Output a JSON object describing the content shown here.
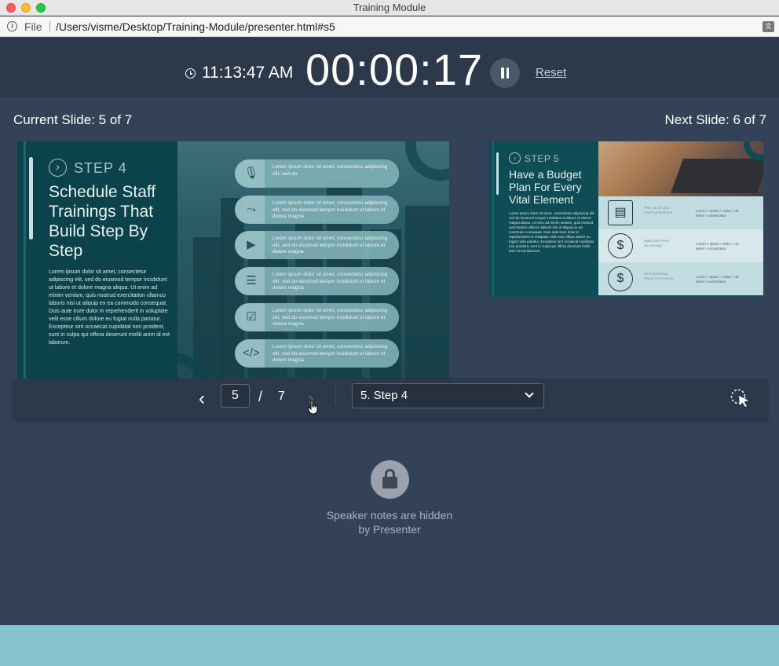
{
  "window": {
    "title": "Training Module"
  },
  "address_bar": {
    "scheme_label": "File",
    "url": "/Users/visme/Desktop/Training-Module/presenter.html#s5"
  },
  "header": {
    "clock_time": "11:13:47 AM",
    "elapsed_time": "00:00:17",
    "reset_label": "Reset"
  },
  "labels": {
    "current_slide": "Current Slide:  5 of 7",
    "next_slide": "Next Slide: 6 of 7"
  },
  "current_slide": {
    "step_label": "STEP 4",
    "title": "Schedule Staff Trainings That Build Step By Step",
    "body": "Lorem ipsum dolor sit amet, consectetur adipiscing elit, sed do eiusmod tempor incididunt ut labore et dolore magna aliqua. Ut enim ad minim veniam, quis nostrud exercitation ullamco laboris nisi ut aliquip ex ea commodo consequat. Duis aute irure dolor in reprehenderit in voluptate velit esse cillum dolore eu fugiat nulla pariatur. Excepteur sint occaecat cupidatat non proident, sunt in culpa qui officia deserunt mollit anim id est laborum.",
    "items": [
      {
        "icon": "microphone-icon",
        "text": "Lorem ipsum dolor sit amet, consectetur adipiscing elit, sed do."
      },
      {
        "icon": "route-icon",
        "text": "Lorem ipsum dolor sit amet, consectetur adipiscing elit, sed do eiusmod tempor incididunt ut labore et dolore magna"
      },
      {
        "icon": "play-video-icon",
        "text": "Lorem ipsum dolor sit amet, consectetur adipiscing elit, sed do eiusmod tempor incididunt ut labore et dolore magna"
      },
      {
        "icon": "equalizer-icon",
        "text": "Lorem ipsum dolor sit amet, consectetur adipiscing elit, sed do eiusmod tempor incididunt ut labore et dolore magna"
      },
      {
        "icon": "checklist-icon",
        "text": "Lorem ipsum dolor sit amet, consectetur adipiscing elit, sed do eiusmod tempor incididunt ut labore et dolore magna"
      },
      {
        "icon": "code-window-icon",
        "text": "Lorem ipsum dolor sit amet, consectetur adipiscing elit, sed do eiusmod tempor incididunt ut labore et dolore magna"
      }
    ]
  },
  "next_slide": {
    "step_label": "STEP 5",
    "title": "Have a Budget Plan For Every Vital Element",
    "body": "Lorem ipsum dolor sit amet, consectetur adipiscing elit, sed do eiusmod tempor incididunt ut labore et dolore magna aliqua. Ut enim ad minim veniam, quis nostrud exercitation ullamco laboris nisi ut aliquip ex ea commodo consequat. Duis aute irure dolor in reprehenderit in voluptate velit esse cillum dolore eu fugiat nulla pariatur. Excepteur sint occaecat cupidatat non proident, sunt in culpa qui officia deserunt mollit anim id est laborum.",
    "rows": [
      {
        "icon": "document-icon",
        "label": "Plan out all your needs beforehand",
        "detail": "Lorem > ipsum > dolor > sit amet > consectetur"
      },
      {
        "icon": "piggy-bank-icon",
        "label": "Make sure there are savings",
        "detail": "Lorem > ipsum > dolor > sit amet > consectetur"
      },
      {
        "icon": "dollar-coin-icon",
        "label": "Set fundraising efforts if necessary",
        "detail": "Lorem > ipsum > dolor > sit amet > consectetur"
      }
    ]
  },
  "navigation": {
    "current_page": "5",
    "separator": "/",
    "total_pages": "7",
    "selected_slide": "5. Step 4"
  },
  "notes": {
    "hidden_message_line1": "Speaker notes are hidden",
    "hidden_message_line2": "by Presenter"
  },
  "colors": {
    "background": "#344257",
    "header": "#2c394b",
    "slide_teal": "#0f4d56",
    "bottom_band": "#86c4d0"
  }
}
